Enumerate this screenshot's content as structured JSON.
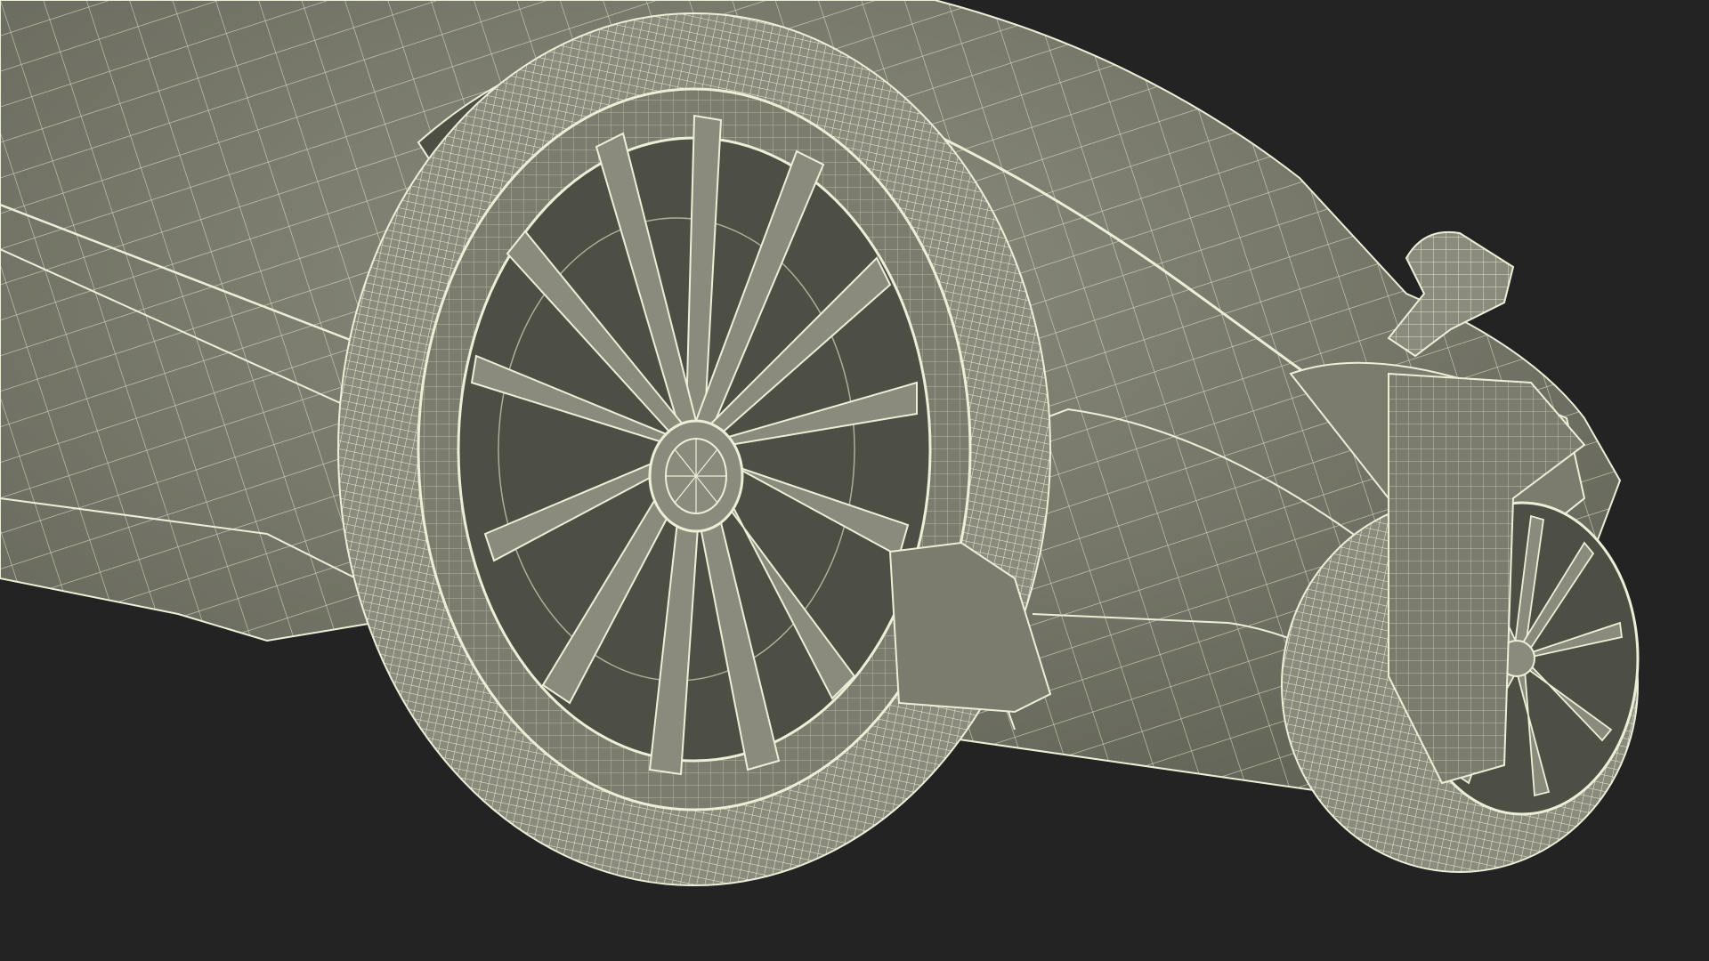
{
  "scene": {
    "background_color": "#232323",
    "body_color": "#7b7c6d",
    "body_shadow_color": "#5e5f53",
    "wire_color": "#ecefd8",
    "wheel_dark_color": "#55564b",
    "tire_color": "#8a8b7c"
  }
}
